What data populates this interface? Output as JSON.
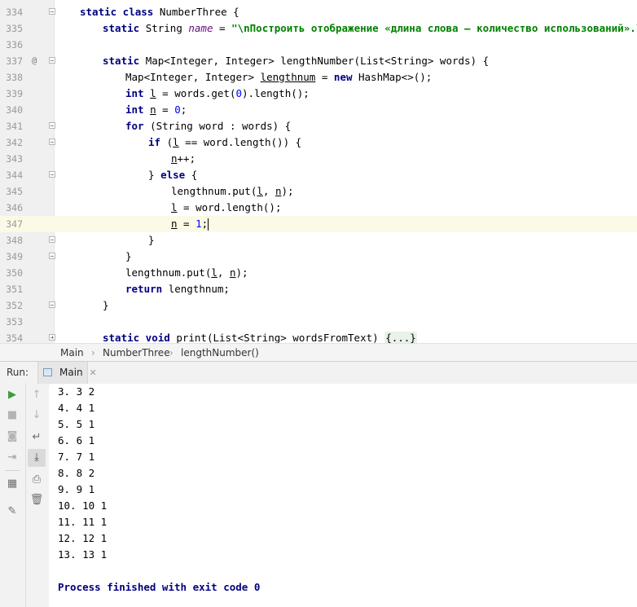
{
  "editor": {
    "lines": [
      {
        "num": "334",
        "fold": "open",
        "indent": 0,
        "code": [
          [
            "kw",
            "static class "
          ],
          [
            "plain",
            "NumberThree {"
          ]
        ]
      },
      {
        "num": "335",
        "fold": "",
        "indent": 1,
        "code": [
          [
            "kw",
            "static "
          ],
          [
            "plain",
            "String "
          ],
          [
            "field",
            "name"
          ],
          [
            "plain",
            " = "
          ],
          [
            "str",
            "\"\\nПостроить отображение «длина слова – количество использований».\\n\""
          ],
          [
            "plain",
            ";"
          ]
        ]
      },
      {
        "num": "336",
        "fold": "",
        "indent": 0,
        "code": []
      },
      {
        "num": "337",
        "fold": "open",
        "marker": "@",
        "indent": 1,
        "code": [
          [
            "kw",
            "static "
          ],
          [
            "plain",
            "Map<Integer, Integer> lengthNumber(List<String> words) {"
          ]
        ]
      },
      {
        "num": "338",
        "fold": "",
        "indent": 2,
        "code": [
          [
            "plain",
            "Map<Integer, Integer> "
          ],
          [
            "var",
            "lengthnum"
          ],
          [
            "plain",
            " = "
          ],
          [
            "kw",
            "new "
          ],
          [
            "plain",
            "HashMap<>();"
          ]
        ]
      },
      {
        "num": "339",
        "fold": "",
        "indent": 2,
        "code": [
          [
            "kw",
            "int "
          ],
          [
            "var",
            "l"
          ],
          [
            "plain",
            " = words.get("
          ],
          [
            "num",
            "0"
          ],
          [
            "plain",
            ").length();"
          ]
        ]
      },
      {
        "num": "340",
        "fold": "",
        "indent": 2,
        "code": [
          [
            "kw",
            "int "
          ],
          [
            "var",
            "n"
          ],
          [
            "plain",
            " = "
          ],
          [
            "num",
            "0"
          ],
          [
            "plain",
            ";"
          ]
        ]
      },
      {
        "num": "341",
        "fold": "open",
        "indent": 2,
        "code": [
          [
            "kw",
            "for "
          ],
          [
            "plain",
            "(String word : words) {"
          ]
        ]
      },
      {
        "num": "342",
        "fold": "open",
        "indent": 3,
        "code": [
          [
            "kw",
            "if "
          ],
          [
            "plain",
            "("
          ],
          [
            "var",
            "l"
          ],
          [
            "plain",
            " == word.length()) {"
          ]
        ]
      },
      {
        "num": "343",
        "fold": "",
        "indent": 4,
        "code": [
          [
            "var",
            "n"
          ],
          [
            "plain",
            "++;"
          ]
        ]
      },
      {
        "num": "344",
        "fold": "open",
        "indent": 3,
        "code": [
          [
            "plain",
            "} "
          ],
          [
            "kw",
            "else "
          ],
          [
            "plain",
            "{"
          ]
        ]
      },
      {
        "num": "345",
        "fold": "",
        "indent": 4,
        "code": [
          [
            "plain",
            "lengthnum.put("
          ],
          [
            "var",
            "l"
          ],
          [
            "plain",
            ", "
          ],
          [
            "var",
            "n"
          ],
          [
            "plain",
            ");"
          ]
        ]
      },
      {
        "num": "346",
        "fold": "",
        "indent": 4,
        "code": [
          [
            "var",
            "l"
          ],
          [
            "plain",
            " = word.length();"
          ]
        ]
      },
      {
        "num": "347",
        "fold": "",
        "indent": 4,
        "current": true,
        "code": [
          [
            "var",
            "n"
          ],
          [
            "plain",
            " = "
          ],
          [
            "num",
            "1"
          ],
          [
            "plain",
            ";"
          ],
          [
            "caret",
            ""
          ]
        ]
      },
      {
        "num": "348",
        "fold": "close",
        "indent": 3,
        "code": [
          [
            "plain",
            "}"
          ]
        ]
      },
      {
        "num": "349",
        "fold": "close",
        "indent": 2,
        "code": [
          [
            "plain",
            "}"
          ]
        ]
      },
      {
        "num": "350",
        "fold": "",
        "indent": 2,
        "code": [
          [
            "plain",
            "lengthnum.put("
          ],
          [
            "var",
            "l"
          ],
          [
            "plain",
            ", "
          ],
          [
            "var",
            "n"
          ],
          [
            "plain",
            ");"
          ]
        ]
      },
      {
        "num": "351",
        "fold": "",
        "indent": 2,
        "code": [
          [
            "kw",
            "return "
          ],
          [
            "plain",
            "lengthnum;"
          ]
        ]
      },
      {
        "num": "352",
        "fold": "close",
        "indent": 1,
        "code": [
          [
            "plain",
            "}"
          ]
        ]
      },
      {
        "num": "353",
        "fold": "",
        "indent": 0,
        "code": []
      },
      {
        "num": "354",
        "fold": "plus",
        "indent": 1,
        "code": [
          [
            "kw",
            "static void "
          ],
          [
            "plain",
            "print(List<String> wordsFromText) "
          ],
          [
            "foldbox",
            "{...}"
          ]
        ]
      }
    ]
  },
  "breadcrumb": {
    "items": [
      "Main",
      "NumberThree",
      "lengthNumber()"
    ]
  },
  "run": {
    "label": "Run:",
    "tab_label": "Main",
    "tab_close": "✕",
    "console_lines": [
      "3. 3 2",
      "4. 4 1",
      "5. 5 1",
      "6. 6 1",
      "7. 7 1",
      "8. 8 2",
      "9. 9 1",
      "10. 10 1",
      "11. 11 1",
      "12. 12 1",
      "13. 13 1",
      "",
      "Process finished with exit code 0"
    ]
  },
  "toolbar": {
    "left": [
      {
        "name": "rerun-icon",
        "glyph": "▶",
        "color": "#3f9a3f"
      },
      {
        "name": "stop-icon",
        "glyph": "■",
        "color": "#b4b4b4"
      },
      {
        "name": "camera-icon",
        "glyph": "◙",
        "color": "#b4b4b4"
      },
      {
        "name": "import-icon",
        "glyph": "⇥",
        "color": "#a0a0a0"
      },
      {
        "name": "layout-icon",
        "glyph": "▦",
        "color": "#6e6e6e"
      },
      {
        "name": "pin-icon",
        "glyph": "✎",
        "color": "#6e6e6e"
      }
    ],
    "right": [
      {
        "name": "scroll-up-icon",
        "glyph": "↑",
        "color": "#b4b4b4"
      },
      {
        "name": "scroll-down-icon",
        "glyph": "↓",
        "color": "#b4b4b4"
      },
      {
        "name": "soft-wrap-icon",
        "glyph": "↵",
        "color": "#6e6e6e"
      },
      {
        "name": "scroll-to-end-icon",
        "glyph": "⤓",
        "color": "#4a4a4a"
      },
      {
        "name": "print-icon",
        "glyph": "⎙",
        "color": "#6e6e6e"
      },
      {
        "name": "trash-icon",
        "glyph": "🗑",
        "color": "#6e6e6e"
      }
    ]
  }
}
